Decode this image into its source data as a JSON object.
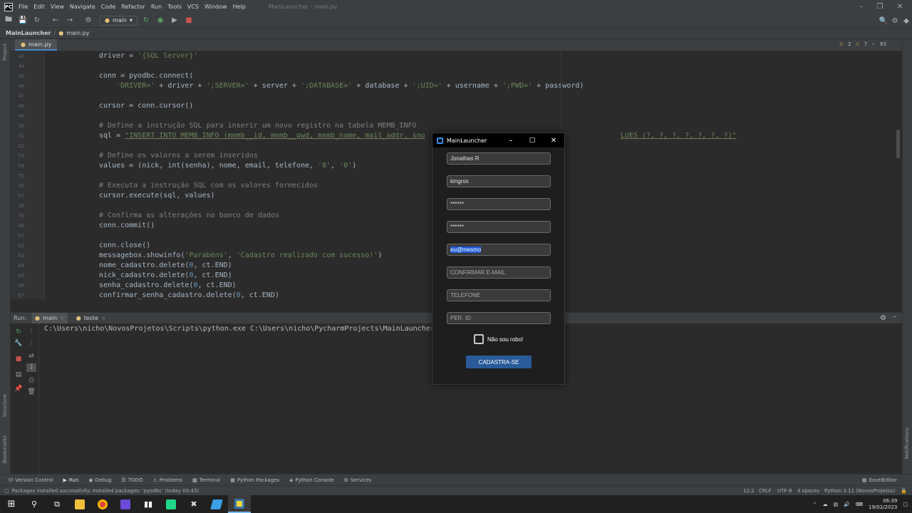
{
  "menubar": {
    "items": [
      "File",
      "Edit",
      "View",
      "Navigate",
      "Code",
      "Refactor",
      "Run",
      "Tools",
      "VCS",
      "Window",
      "Help"
    ],
    "title": "MainLauncher - main.py"
  },
  "toolbar": {
    "run_config": "main"
  },
  "navbar": {
    "project": "MainLauncher",
    "file": "main.py"
  },
  "side": {
    "project": "Project",
    "structure": "Structure",
    "bookmarks": "Bookmarks",
    "notifications": "Notifications"
  },
  "editor": {
    "tab": "main.py",
    "inspections": {
      "warnings": "2",
      "weak": "7",
      "typos": "63"
    },
    "line_numbers": [
      "43",
      "44",
      "45",
      "46",
      "47",
      "48",
      "49",
      "50",
      "51",
      "52",
      "53",
      "54",
      "55",
      "56",
      "57",
      "58",
      "59",
      "60",
      "61",
      "62",
      "63",
      "64",
      "65",
      "66",
      "67"
    ],
    "lines": {
      "l43": "driver = '{SQL Server}'",
      "l45": "conn = pyodbc.connect(",
      "l46": "    'DRIVER=' + driver + ';SERVER=' + server + ';DATABASE=' + database + ';UID=' + username + ';PWD=' + password)",
      "l48": "cursor = conn.cursor()",
      "l50": "# Define a instrução SQL para inserir um novo registro na tabela MEMB_INFO",
      "l51a": "sql = ",
      "l51b": "\"INSERT INTO MEMB_INFO (memb__id, memb__pwd, memb_name, mail_addr, sno",
      "l51c": "LUES (?, ?, ?, ?, ?, ?, ?)\"",
      "l53": "# Define os valores a serem inseridos",
      "l54": "values = (nick, int(senha), nome, email, telefone, '0', '0')",
      "l56": "# Executa a instrução SQL com os valores fornecidos",
      "l57": "cursor.execute(sql, values)",
      "l59": "# Confirma as alterações no banco de dados",
      "l60": "conn.commit()",
      "l62": "conn.close()",
      "l63": "messagebox.showinfo('Parabéns', 'Cadastro realizado com sucesso!')",
      "l64": "nome_cadastro.delete(0, ct.END)",
      "l65": "nick_cadastro.delete(0, ct.END)",
      "l66": "senha_cadastro.delete(0, ct.END)",
      "l67": "confirmar_senha_cadastro.delete(0, ct.END)"
    }
  },
  "run": {
    "label": "Run:",
    "tabs": [
      "main",
      "teste"
    ],
    "console_line": "C:\\Users\\nicho\\NovosProjetos\\Scripts\\python.exe C:\\Users\\nicho\\PycharmProjects\\MainLauncher"
  },
  "bottom_tabs": [
    "Version Control",
    "Run",
    "Debug",
    "TODO",
    "Problems",
    "Terminal",
    "Python Packages",
    "Python Console",
    "Services"
  ],
  "bottom_right": "ExcelEditor",
  "status": {
    "message": "Packages installed successfully: Installed packages: 'pyodbc' (today 03:43)",
    "position": "12:2",
    "line_sep": "CRLF",
    "encoding": "UTF-8",
    "indent": "4 spaces",
    "interpreter": "Python 3.11 (NovosProjetos)"
  },
  "dialog": {
    "title": "MainLauncher",
    "fields": {
      "name": "Jonathas R",
      "nick": "kingrox",
      "password": "******",
      "confirm_password": "******",
      "email": "eu@mesmo",
      "confirm_email": "CONFIRMAR E-MAIL",
      "phone": "TELEFONE",
      "per_id": "PER. ID"
    },
    "checkbox_label": "Não sou robo!",
    "submit": "CADASTRA-SE"
  },
  "taskbar": {
    "time": "06:39",
    "date": "19/02/2023"
  },
  "colors": {
    "ide_bg": "#2b2b2b",
    "panel": "#3c3f41",
    "dialog_bg": "#1e1e1e",
    "button": "#2a5a9a",
    "selection": "#1f5bd8"
  }
}
